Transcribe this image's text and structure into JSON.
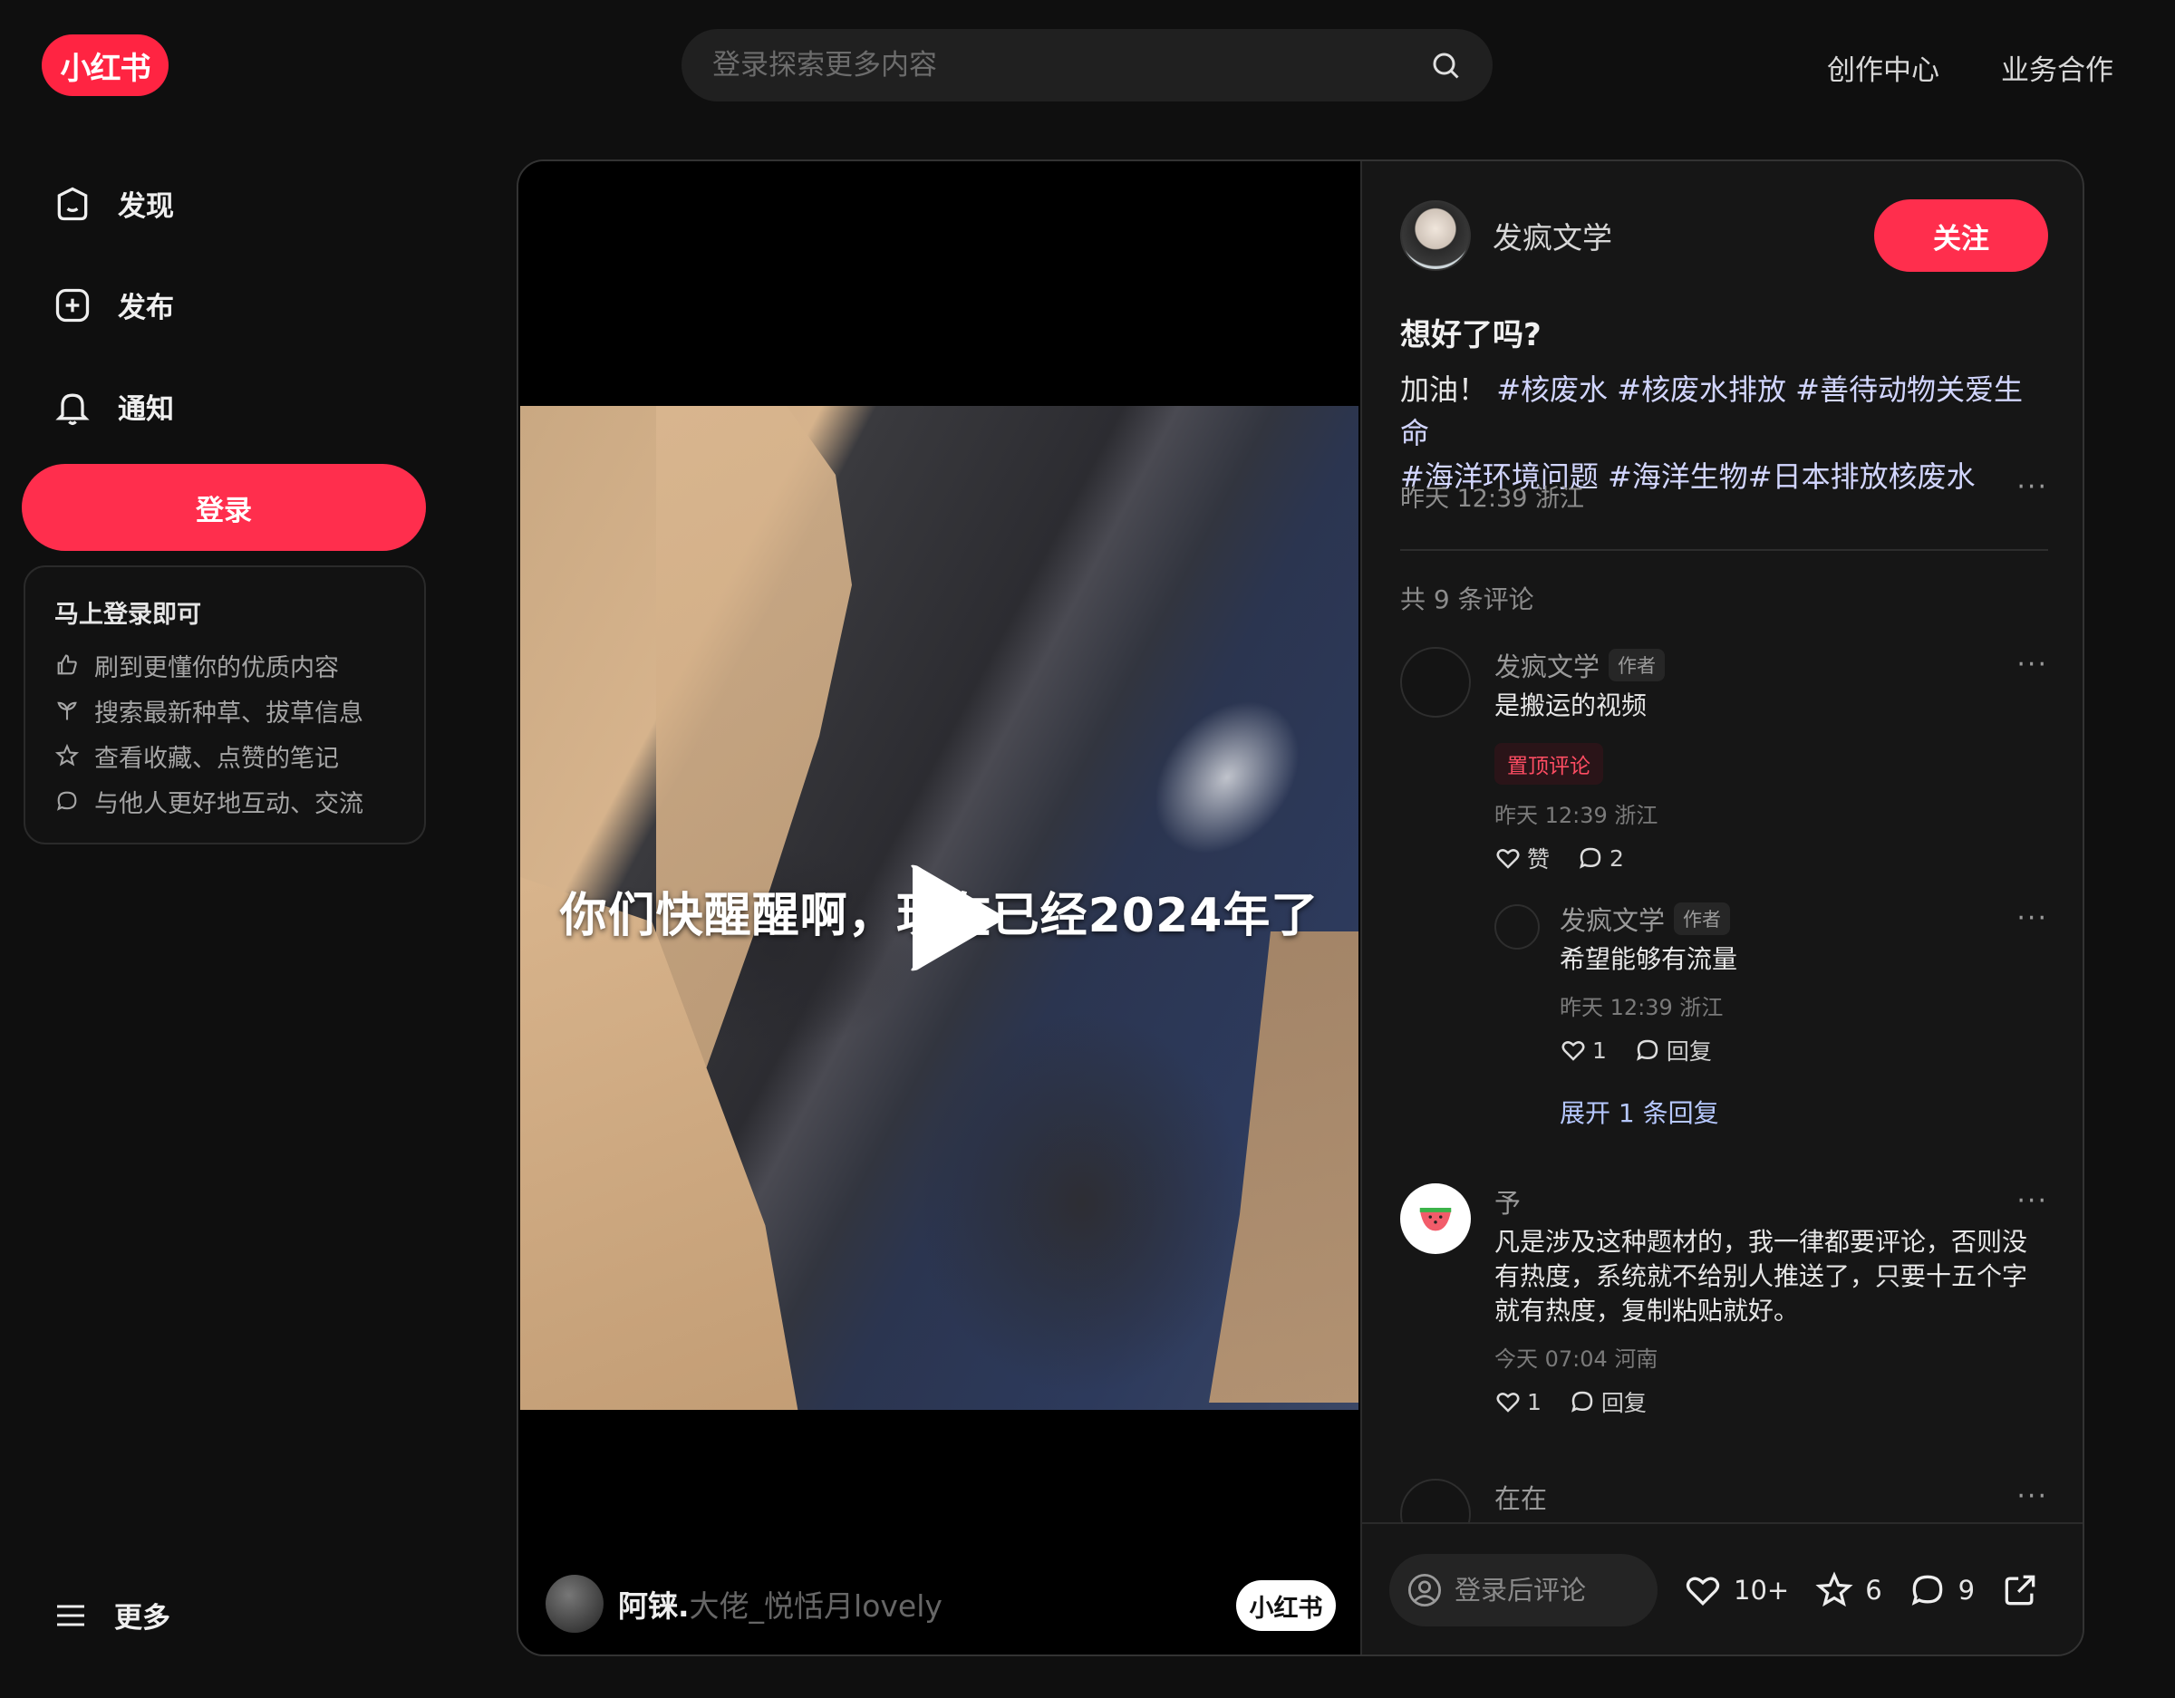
{
  "header": {
    "logo_text": "小红书",
    "search_placeholder": "登录探索更多内容",
    "links": [
      "创作中心",
      "业务合作"
    ]
  },
  "sidebar": {
    "items": [
      {
        "label": "发现",
        "icon": "home-icon"
      },
      {
        "label": "发布",
        "icon": "plus-square-icon"
      },
      {
        "label": "通知",
        "icon": "bell-icon"
      }
    ],
    "login_button": "登录",
    "login_card": {
      "title": "马上登录即可",
      "rows": [
        {
          "icon": "thumb-up-icon",
          "text": "刷到更懂你的优质内容"
        },
        {
          "icon": "sprout-icon",
          "text": "搜索最新种草、拔草信息"
        },
        {
          "icon": "star-icon",
          "text": "查看收藏、点赞的笔记"
        },
        {
          "icon": "chat-icon",
          "text": "与他人更好地互动、交流"
        }
      ]
    },
    "more_label": "更多"
  },
  "video": {
    "subtitle": "你们快醒醒啊，现在已经2024年了",
    "uploader_name": "阿铼.",
    "uploader_faded": "大佬_悦恬月lovely",
    "watermark": "小红书"
  },
  "post": {
    "author": "发疯文学",
    "follow_label": "关注",
    "title": "想好了吗?",
    "body_prefix": "加油！",
    "tags_line1": "#核废水 #核废水排放 #善待动物关爱生命",
    "tags_line2": "#海洋环境问题 #海洋生物#日本排放核废水",
    "meta": "昨天 12:39 浙江",
    "comment_count": "共 9 条评论"
  },
  "comments": [
    {
      "name": "发疯文学",
      "badge": "作者",
      "text": "是搬运的视频",
      "pin": "置顶评论",
      "meta": "昨天 12:39 浙江",
      "like": "赞",
      "reply": "2"
    },
    {
      "name": "发疯文学",
      "badge": "作者",
      "text": "希望能够有流量",
      "meta": "昨天 12:39 浙江",
      "like": "1",
      "reply": "回复",
      "expand": "展开 1 条回复"
    },
    {
      "name": "予",
      "text": "凡是涉及这种题材的，我一律都要评论，否则没有热度，系统就不给别人推送了，只要十五个字就有热度，复制粘贴就好。",
      "meta": "今天 07:04 河南",
      "like": "1",
      "reply": "回复"
    },
    {
      "name": "在在"
    }
  ],
  "bottom_bar": {
    "comment_placeholder": "登录后评论",
    "likes": "10+",
    "favorites": "6",
    "comments": "9"
  },
  "colors": {
    "brand_red": "#ff2442",
    "background": "#0f0f0f"
  }
}
